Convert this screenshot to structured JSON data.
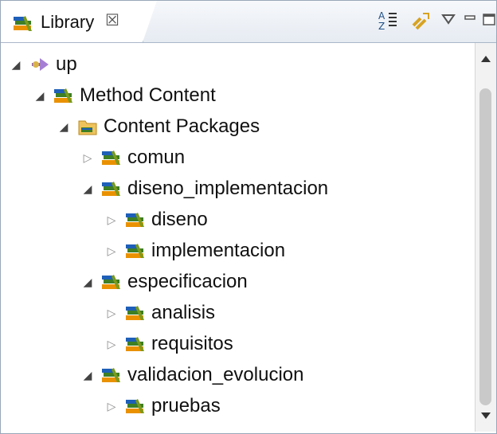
{
  "view": {
    "title": "Library",
    "close": "☒",
    "tools": [
      "A-Z",
      "⇄",
      "▽",
      "▭",
      "□"
    ]
  },
  "tree": [
    {
      "label": "up",
      "icon": "plugin-icon",
      "level": 0,
      "expanded": true
    },
    {
      "label": "Method Content",
      "icon": "library-icon",
      "level": 1,
      "expanded": true
    },
    {
      "label": "Content Packages",
      "icon": "folder-icon",
      "level": 2,
      "expanded": true
    },
    {
      "label": "comun",
      "icon": "library-icon",
      "level": 3,
      "expanded": false
    },
    {
      "label": "diseno_implementacion",
      "icon": "library-icon",
      "level": 3,
      "expanded": true
    },
    {
      "label": "diseno",
      "icon": "library-icon",
      "level": 4,
      "expanded": false
    },
    {
      "label": "implementacion",
      "icon": "library-icon",
      "level": 4,
      "expanded": false
    },
    {
      "label": "especificacion",
      "icon": "library-icon",
      "level": 3,
      "expanded": true
    },
    {
      "label": "analisis",
      "icon": "library-icon",
      "level": 4,
      "expanded": false
    },
    {
      "label": "requisitos",
      "icon": "library-icon",
      "level": 4,
      "expanded": false
    },
    {
      "label": "validacion_evolucion",
      "icon": "library-icon",
      "level": 3,
      "expanded": true
    },
    {
      "label": "pruebas",
      "icon": "library-icon",
      "level": 4,
      "expanded": false
    }
  ],
  "colors": {
    "library_green": "#3d7f25",
    "library_orange": "#e99100",
    "library_blue": "#1e5fb8",
    "folder": "#efc35b"
  }
}
